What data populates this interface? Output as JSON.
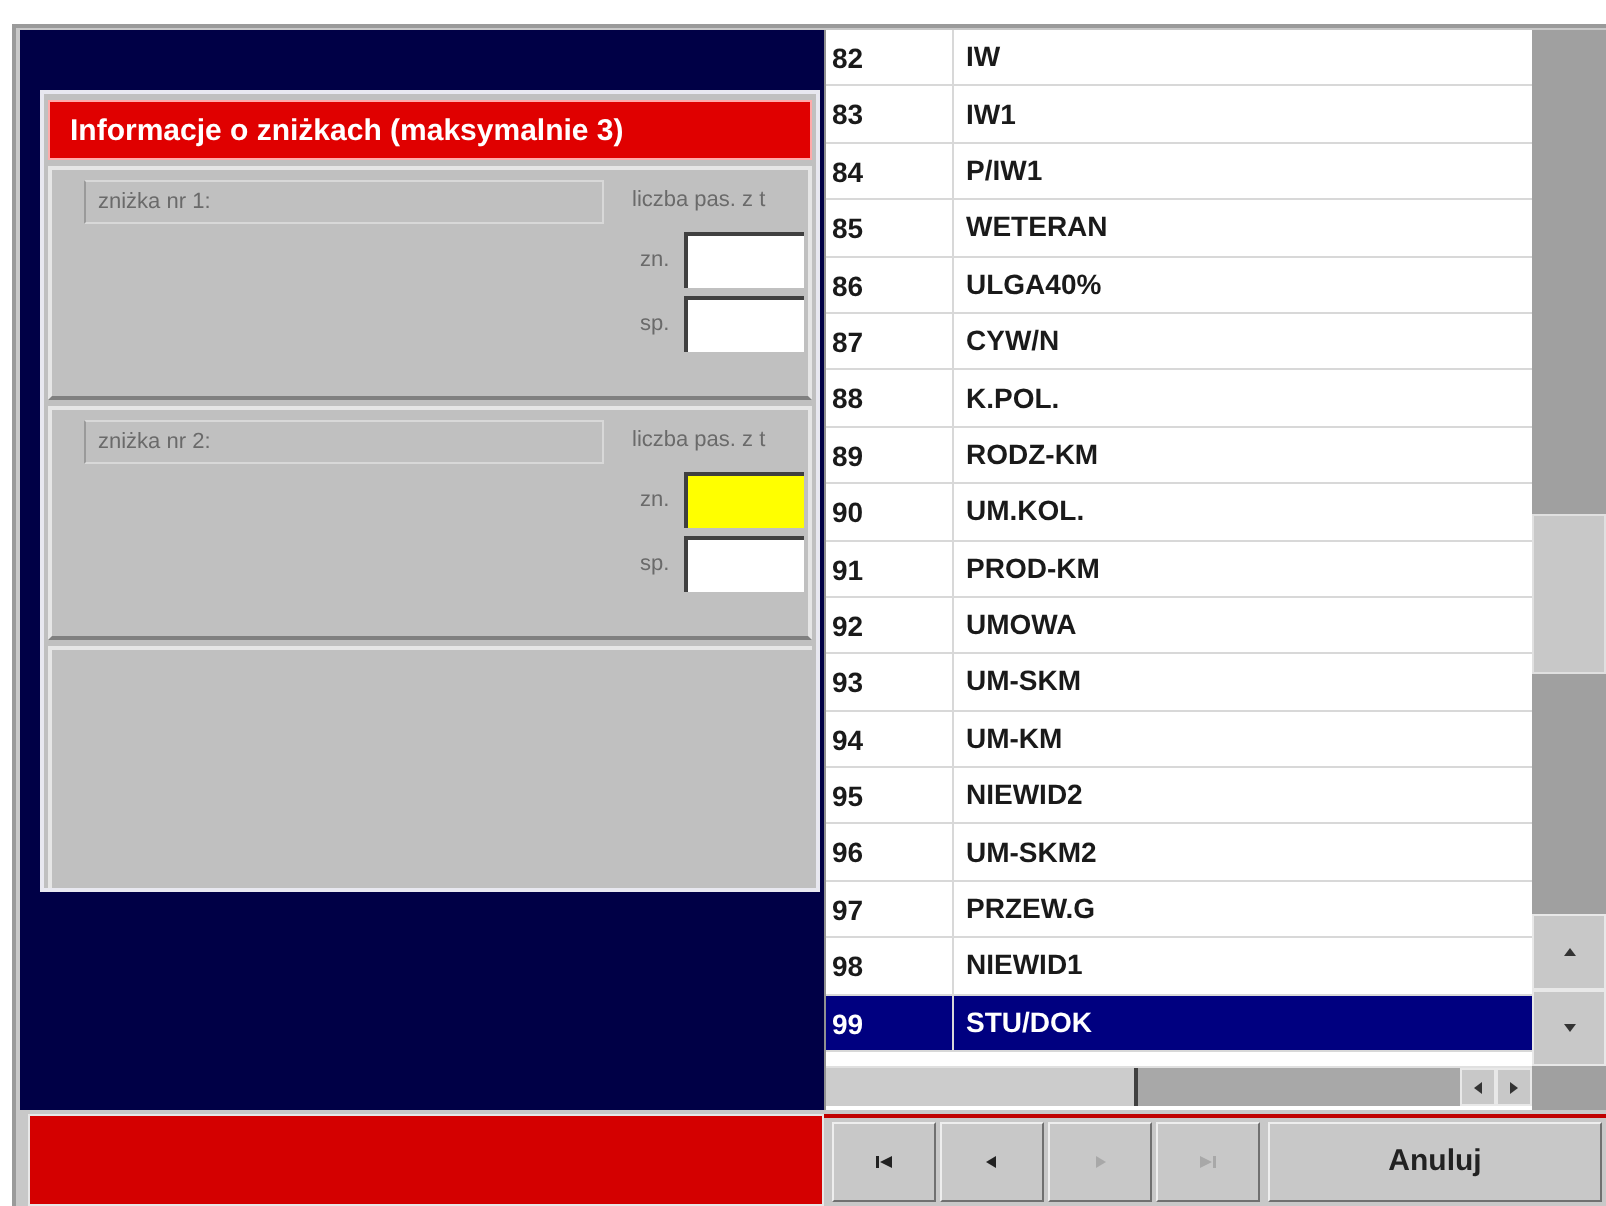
{
  "form": {
    "title": "Informacje o zniżkach (maksymalnie 3)",
    "discounts": [
      {
        "label": "zniżka nr 1:",
        "count_label": "liczba pas. z t",
        "fields": [
          {
            "label": "zn.",
            "focused": false
          },
          {
            "label": "sp.",
            "focused": false
          }
        ]
      },
      {
        "label": "zniżka nr 2:",
        "count_label": "liczba pas. z t",
        "fields": [
          {
            "label": "zn.",
            "focused": true
          },
          {
            "label": "sp.",
            "focused": false
          }
        ]
      }
    ]
  },
  "list": {
    "rows": [
      {
        "number": "82",
        "name": "IW",
        "selected": false
      },
      {
        "number": "83",
        "name": "IW1",
        "selected": false
      },
      {
        "number": "84",
        "name": "P/IW1",
        "selected": false
      },
      {
        "number": "85",
        "name": "WETERAN",
        "selected": false
      },
      {
        "number": "86",
        "name": "ULGA40%",
        "selected": false
      },
      {
        "number": "87",
        "name": "CYW/N",
        "selected": false
      },
      {
        "number": "88",
        "name": "K.POL.",
        "selected": false
      },
      {
        "number": "89",
        "name": "RODZ-KM",
        "selected": false
      },
      {
        "number": "90",
        "name": "UM.KOL.",
        "selected": false
      },
      {
        "number": "91",
        "name": "PROD-KM",
        "selected": false
      },
      {
        "number": "92",
        "name": "UMOWA",
        "selected": false
      },
      {
        "number": "93",
        "name": "UM-SKM",
        "selected": false
      },
      {
        "number": "94",
        "name": "UM-KM",
        "selected": false
      },
      {
        "number": "95",
        "name": "NIEWID2",
        "selected": false
      },
      {
        "number": "96",
        "name": "UM-SKM2",
        "selected": false
      },
      {
        "number": "97",
        "name": "PRZEW.G",
        "selected": false
      },
      {
        "number": "98",
        "name": "NIEWID1",
        "selected": false
      },
      {
        "number": "99",
        "name": "STU/DOK",
        "selected": true
      }
    ]
  },
  "navigation": [
    {
      "kind": "first",
      "disabled": false
    },
    {
      "kind": "previous",
      "disabled": false
    },
    {
      "kind": "next",
      "disabled": true
    },
    {
      "kind": "last",
      "disabled": true
    }
  ],
  "cancel_button": "Anuluj"
}
